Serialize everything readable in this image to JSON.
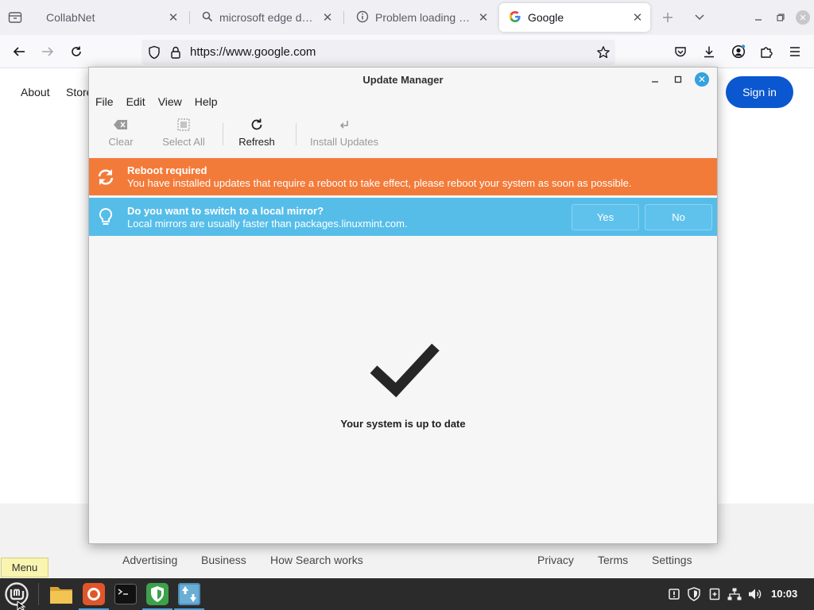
{
  "browser": {
    "tabs": [
      {
        "title": "CollabNet",
        "active": false,
        "favicon": "none"
      },
      {
        "title": "microsoft edge dev -",
        "active": false,
        "favicon": "search-icon"
      },
      {
        "title": "Problem loading page",
        "active": false,
        "favicon": "info-icon"
      },
      {
        "title": "Google",
        "active": true,
        "favicon": "google-g-icon"
      }
    ],
    "url": "https://www.google.com"
  },
  "google": {
    "top_links": [
      "About",
      "Store"
    ],
    "sign_in": "Sign in",
    "footer_left": [
      "Advertising",
      "Business",
      "How Search works"
    ],
    "footer_right": [
      "Privacy",
      "Terms",
      "Settings"
    ]
  },
  "update_manager": {
    "title": "Update Manager",
    "menu": [
      "File",
      "Edit",
      "View",
      "Help"
    ],
    "toolbar": {
      "clear": "Clear",
      "select_all": "Select All",
      "refresh": "Refresh",
      "install_updates": "Install Updates"
    },
    "reboot": {
      "title": "Reboot required",
      "message": "You have installed updates that require a reboot to take effect, please reboot your system as soon as possible.",
      "color": "#f37b3a"
    },
    "mirror": {
      "title": "Do you want to switch to a local mirror?",
      "message": "Local mirrors are usually faster than packages.linuxmint.com.",
      "yes": "Yes",
      "no": "No",
      "color": "#56bde9"
    },
    "status": "Your system is up to date"
  },
  "taskbar": {
    "menu_tooltip": "Menu",
    "apps": [
      "files-icon",
      "firefox-icon",
      "terminal-icon",
      "shield-app-icon",
      "update-manager-icon"
    ],
    "tray": [
      "update-tray-icon",
      "shield-tray-icon",
      "clipboard-icon",
      "network-icon",
      "volume-icon"
    ],
    "clock": "10:03"
  }
}
